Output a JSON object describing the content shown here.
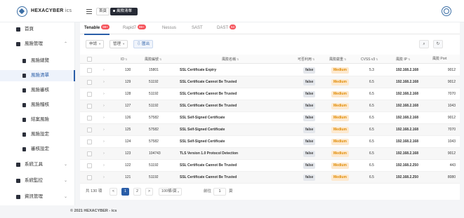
{
  "header": {
    "brand": "HEXACYBER",
    "brand_suffix": "ics",
    "tags": [
      "首頁",
      "風險清單"
    ]
  },
  "sidebar": {
    "items": [
      {
        "label": "首頁",
        "icon": "dashboard-icon"
      },
      {
        "label": "風險管理",
        "icon": "risk-icon"
      },
      {
        "label": "風險總覽",
        "icon": "document-icon"
      },
      {
        "label": "風險清單",
        "icon": "document-icon"
      },
      {
        "label": "風險審核",
        "icon": "document-icon"
      },
      {
        "label": "風險稽核",
        "icon": "document-icon"
      },
      {
        "label": "結案風險",
        "icon": "document-icon"
      },
      {
        "label": "風險設定",
        "icon": "settings-icon"
      },
      {
        "label": "審核設定",
        "icon": "settings-icon"
      },
      {
        "label": "系統工具",
        "icon": "tools-icon"
      },
      {
        "label": "系統監控",
        "icon": "monitor-icon"
      },
      {
        "label": "資訊管理",
        "icon": "info-icon"
      }
    ]
  },
  "tabs": [
    {
      "label": "Tenable",
      "badge": "99+"
    },
    {
      "label": "Rapid7",
      "badge": "99+"
    },
    {
      "label": "Nessus",
      "badge": ""
    },
    {
      "label": "SAST",
      "badge": ""
    },
    {
      "label": "DAST",
      "badge": "53"
    }
  ],
  "toolbar": {
    "filter1": "申請",
    "filter2": "管理",
    "export": "匯出"
  },
  "table": {
    "headers": [
      "ID",
      "風險編號",
      "風險名稱",
      "可否利用",
      "風險嚴重",
      "CVSS v3",
      "風險 IP",
      "風險 Port"
    ],
    "rows": [
      {
        "id": "130",
        "code": "15801",
        "name": "SSL Certificate Expiry",
        "exploit": "false",
        "severity": "Medium",
        "cvss": "5.3",
        "ip": "192.168.2.168",
        "port": "9012"
      },
      {
        "id": "129",
        "code": "51192",
        "name": "SSL Certificate Cannot Be Trusted",
        "exploit": "false",
        "severity": "Medium",
        "cvss": "6.5",
        "ip": "192.168.2.168",
        "port": "9012"
      },
      {
        "id": "128",
        "code": "51192",
        "name": "SSL Certificate Cannot Be Trusted",
        "exploit": "false",
        "severity": "Medium",
        "cvss": "6.5",
        "ip": "192.168.2.168",
        "port": "7070"
      },
      {
        "id": "127",
        "code": "51192",
        "name": "SSL Certificate Cannot Be Trusted",
        "exploit": "false",
        "severity": "Medium",
        "cvss": "6.5",
        "ip": "192.168.2.168",
        "port": "1043"
      },
      {
        "id": "126",
        "code": "57582",
        "name": "SSL Self-Signed Certificate",
        "exploit": "false",
        "severity": "Medium",
        "cvss": "6.5",
        "ip": "192.168.2.168",
        "port": "9012"
      },
      {
        "id": "125",
        "code": "57582",
        "name": "SSL Self-Signed Certificate",
        "exploit": "false",
        "severity": "Medium",
        "cvss": "6.5",
        "ip": "192.168.2.168",
        "port": "7070"
      },
      {
        "id": "124",
        "code": "57582",
        "name": "SSL Self-Signed Certificate",
        "exploit": "false",
        "severity": "Medium",
        "cvss": "6.5",
        "ip": "192.168.2.168",
        "port": "1043"
      },
      {
        "id": "123",
        "code": "104743",
        "name": "TLS Version 1.0 Protocol Detection",
        "exploit": "false",
        "severity": "Medium",
        "cvss": "6.5",
        "ip": "192.168.2.168",
        "port": "9012"
      },
      {
        "id": "122",
        "code": "51192",
        "name": "SSL Certificate Cannot Be Trusted",
        "exploit": "false",
        "severity": "Medium",
        "cvss": "6.5",
        "ip": "192.168.2.250",
        "port": "443"
      },
      {
        "id": "121",
        "code": "51192",
        "name": "SSL Certificate Cannot Be Trusted",
        "exploit": "false",
        "severity": "Medium",
        "cvss": "6.5",
        "ip": "192.168.2.250",
        "port": "8080"
      }
    ]
  },
  "pagination": {
    "total": "共 130 項",
    "prev": "<",
    "pages": [
      "1",
      "2"
    ],
    "next": ">",
    "page_size": "100條/頁",
    "goto_label": "前往",
    "goto_value": "1",
    "goto_unit": "頁"
  },
  "footer": "© 2021 HEXACYBER - ics",
  "colors": {
    "accent": "#2a5ea8",
    "severity_medium_bg": "#fde9cf",
    "severity_medium_text": "#e08a00",
    "badge": "#f5535b"
  }
}
